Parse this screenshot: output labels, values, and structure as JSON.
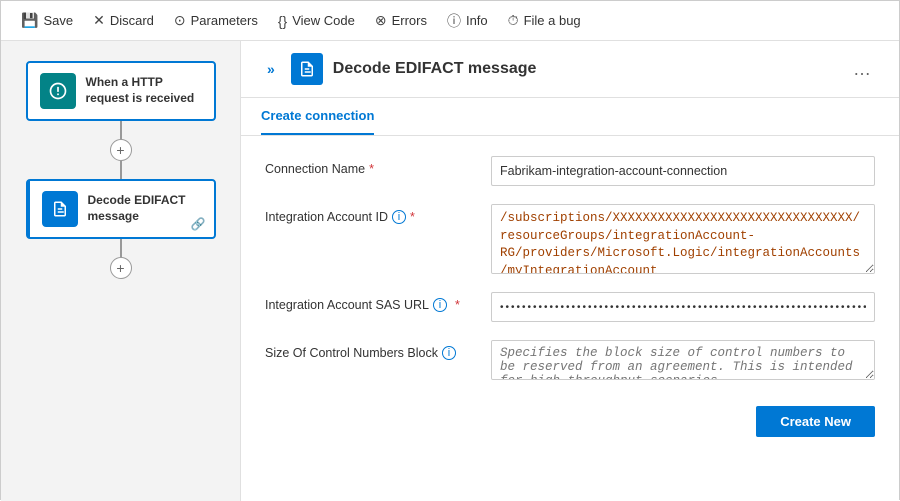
{
  "toolbar": {
    "items": [
      {
        "id": "save",
        "label": "Save",
        "icon": "💾"
      },
      {
        "id": "discard",
        "label": "Discard",
        "icon": "✕"
      },
      {
        "id": "parameters",
        "label": "Parameters",
        "icon": "⊙"
      },
      {
        "id": "view-code",
        "label": "View Code",
        "icon": "{}"
      },
      {
        "id": "errors",
        "label": "Errors",
        "icon": "⊗"
      },
      {
        "id": "info",
        "label": "Info",
        "icon": "ⓘ"
      },
      {
        "id": "file-a-bug",
        "label": "File a bug",
        "icon": "⏱"
      }
    ]
  },
  "left_panel": {
    "trigger_card": {
      "label": "When a HTTP request is received",
      "icon": "⚡"
    },
    "action_card": {
      "label": "Decode EDIFACT message",
      "icon": "📄"
    },
    "plus_label": "+"
  },
  "right_panel": {
    "header": {
      "title": "Decode EDIFACT message",
      "more_icon": "…"
    },
    "tabs": [
      {
        "id": "create-connection",
        "label": "Create connection",
        "active": true
      }
    ],
    "form": {
      "connection_name": {
        "label": "Connection Name",
        "required": true,
        "value": "Fabrikam-integration-account-connection"
      },
      "integration_account_id": {
        "label": "Integration Account ID",
        "required": true,
        "has_info": true,
        "value": "/subscriptions/XXXXXXXXXXXXXXXXXXXXXXXXXXXXXXXX/resourceGroups/integrationAccount-RG/providers/Microsoft.Logic/integrationAccounts/myIntegrationAccount"
      },
      "integration_account_sas_url": {
        "label": "Integration Account SAS URL",
        "required": true,
        "has_info": true,
        "value": "••••••••••••••••••••••••••••••••••••••••••••••••••••••••••••••••••••••••••..."
      },
      "size_of_control_numbers_block": {
        "label": "Size Of Control Numbers Block",
        "has_info": true,
        "placeholder": "Specifies the block size of control numbers to be reserved from an agreement. This is intended for high throughput scenarios"
      },
      "create_button_label": "Create New"
    }
  }
}
